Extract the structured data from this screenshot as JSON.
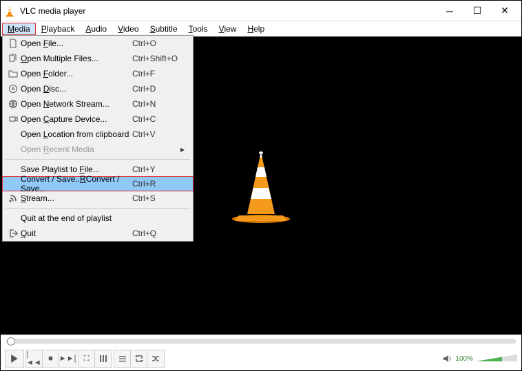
{
  "title": "VLC media player",
  "menubar": [
    {
      "label": "Media",
      "ul": "M",
      "active": true
    },
    {
      "label": "Playback",
      "ul": "P"
    },
    {
      "label": "Audio",
      "ul": "A"
    },
    {
      "label": "Video",
      "ul": "V"
    },
    {
      "label": "Subtitle",
      "ul": "S"
    },
    {
      "label": "Tools",
      "ul": "T"
    },
    {
      "label": "View",
      "ul": "V"
    },
    {
      "label": "Help",
      "ul": "H"
    }
  ],
  "dropdown": [
    {
      "icon": "file-icon",
      "label": "Open File...",
      "ul": "F",
      "shortcut": "Ctrl+O"
    },
    {
      "icon": "files-icon",
      "label": "Open Multiple Files...",
      "ul": "O",
      "shortcut": "Ctrl+Shift+O"
    },
    {
      "icon": "folder-icon",
      "label": "Open Folder...",
      "ul": "F",
      "shortcut": "Ctrl+F"
    },
    {
      "icon": "disc-icon",
      "label": "Open Disc...",
      "ul": "D",
      "shortcut": "Ctrl+D"
    },
    {
      "icon": "network-icon",
      "label": "Open Network Stream...",
      "ul": "N",
      "shortcut": "Ctrl+N"
    },
    {
      "icon": "capture-icon",
      "label": "Open Capture Device...",
      "ul": "C",
      "shortcut": "Ctrl+C"
    },
    {
      "icon": "",
      "label": "Open Location from clipboard",
      "ul": "L",
      "shortcut": "Ctrl+V"
    },
    {
      "icon": "",
      "label": "Open Recent Media",
      "ul": "R",
      "shortcut": "",
      "disabled": true,
      "submenu": true
    },
    {
      "sep": true
    },
    {
      "icon": "",
      "label": "Save Playlist to File...",
      "ul": "F",
      "shortcut": "Ctrl+Y"
    },
    {
      "icon": "",
      "label": "Convert / Save...",
      "ul": "R",
      "shortcut": "Ctrl+R",
      "highlight": true
    },
    {
      "icon": "stream-icon",
      "label": "Stream...",
      "ul": "S",
      "shortcut": "Ctrl+S"
    },
    {
      "sep": true
    },
    {
      "icon": "",
      "label": "Quit at the end of playlist",
      "ul": "",
      "shortcut": ""
    },
    {
      "icon": "quit-icon",
      "label": "Quit",
      "ul": "Q",
      "shortcut": "Ctrl+Q"
    }
  ],
  "volume_pct": "100%"
}
